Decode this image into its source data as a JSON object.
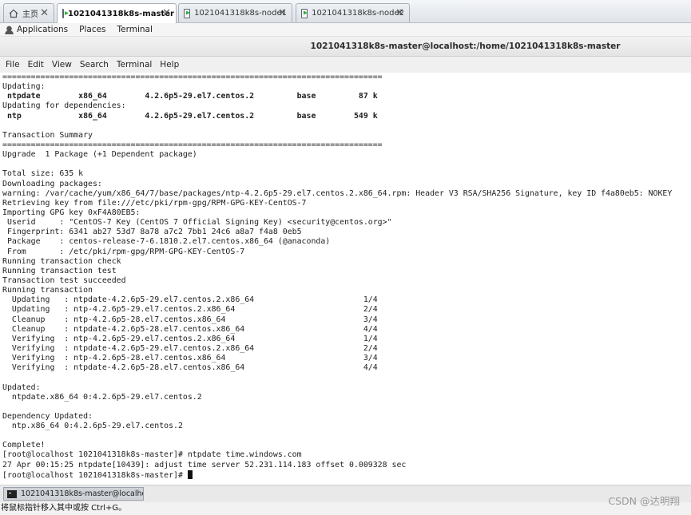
{
  "vm_tabs": [
    {
      "label": "主页",
      "icon": "home-icon",
      "active": false
    },
    {
      "label": "1021041318k8s-master",
      "icon": "vm-icon",
      "active": true
    },
    {
      "label": "1021041318k8s-node1",
      "icon": "vm-icon",
      "active": false
    },
    {
      "label": "1021041318k8s-node2",
      "icon": "vm-icon",
      "active": false
    }
  ],
  "top_bar": {
    "applications": "Applications",
    "places": "Places",
    "terminal": "Terminal"
  },
  "window_title": "1021041318k8s-master@localhost:/home/1021041318k8s-master",
  "menu": [
    "File",
    "Edit",
    "View",
    "Search",
    "Terminal",
    "Help"
  ],
  "terminal_lines": [
    "================================================================================",
    "Updating:",
    " ntpdate        x86_64        4.2.6p5-29.el7.centos.2         base         87 k",
    "Updating for dependencies:",
    " ntp            x86_64        4.2.6p5-29.el7.centos.2         base        549 k",
    "",
    "Transaction Summary",
    "================================================================================",
    "Upgrade  1 Package (+1 Dependent package)",
    "",
    "Total size: 635 k",
    "Downloading packages:",
    "warning: /var/cache/yum/x86_64/7/base/packages/ntp-4.2.6p5-29.el7.centos.2.x86_64.rpm: Header V3 RSA/SHA256 Signature, key ID f4a80eb5: NOKEY",
    "Retrieving key from file:///etc/pki/rpm-gpg/RPM-GPG-KEY-CentOS-7",
    "Importing GPG key 0xF4A80EB5:",
    " Userid     : \"CentOS-7 Key (CentOS 7 Official Signing Key) <security@centos.org>\"",
    " Fingerprint: 6341 ab27 53d7 8a78 a7c2 7bb1 24c6 a8a7 f4a8 0eb5",
    " Package    : centos-release-7-6.1810.2.el7.centos.x86_64 (@anaconda)",
    " From       : /etc/pki/rpm-gpg/RPM-GPG-KEY-CentOS-7",
    "Running transaction check",
    "Running transaction test",
    "Transaction test succeeded",
    "Running transaction",
    "  Updating   : ntpdate-4.2.6p5-29.el7.centos.2.x86_64                       1/4",
    "  Updating   : ntp-4.2.6p5-29.el7.centos.2.x86_64                           2/4",
    "  Cleanup    : ntp-4.2.6p5-28.el7.centos.x86_64                             3/4",
    "  Cleanup    : ntpdate-4.2.6p5-28.el7.centos.x86_64                         4/4",
    "  Verifying  : ntp-4.2.6p5-29.el7.centos.2.x86_64                           1/4",
    "  Verifying  : ntpdate-4.2.6p5-29.el7.centos.2.x86_64                       2/4",
    "  Verifying  : ntp-4.2.6p5-28.el7.centos.x86_64                             3/4",
    "  Verifying  : ntpdate-4.2.6p5-28.el7.centos.x86_64                         4/4",
    "",
    "Updated:",
    "  ntpdate.x86_64 0:4.2.6p5-29.el7.centos.2",
    "",
    "Dependency Updated:",
    "  ntp.x86_64 0:4.2.6p5-29.el7.centos.2",
    "",
    "Complete!",
    "[root@localhost 1021041318k8s-master]# ntpdate time.windows.com",
    "27 Apr 00:15:25 ntpdate[10439]: adjust time server 52.231.114.183 offset 0.009328 sec",
    "[root@localhost 1021041318k8s-master]# "
  ],
  "taskbar_item": "1021041318k8s-master@localhost...",
  "status_text": "将鼠标指针移入其中或按 Ctrl+G。",
  "watermark": "CSDN @达明翔"
}
